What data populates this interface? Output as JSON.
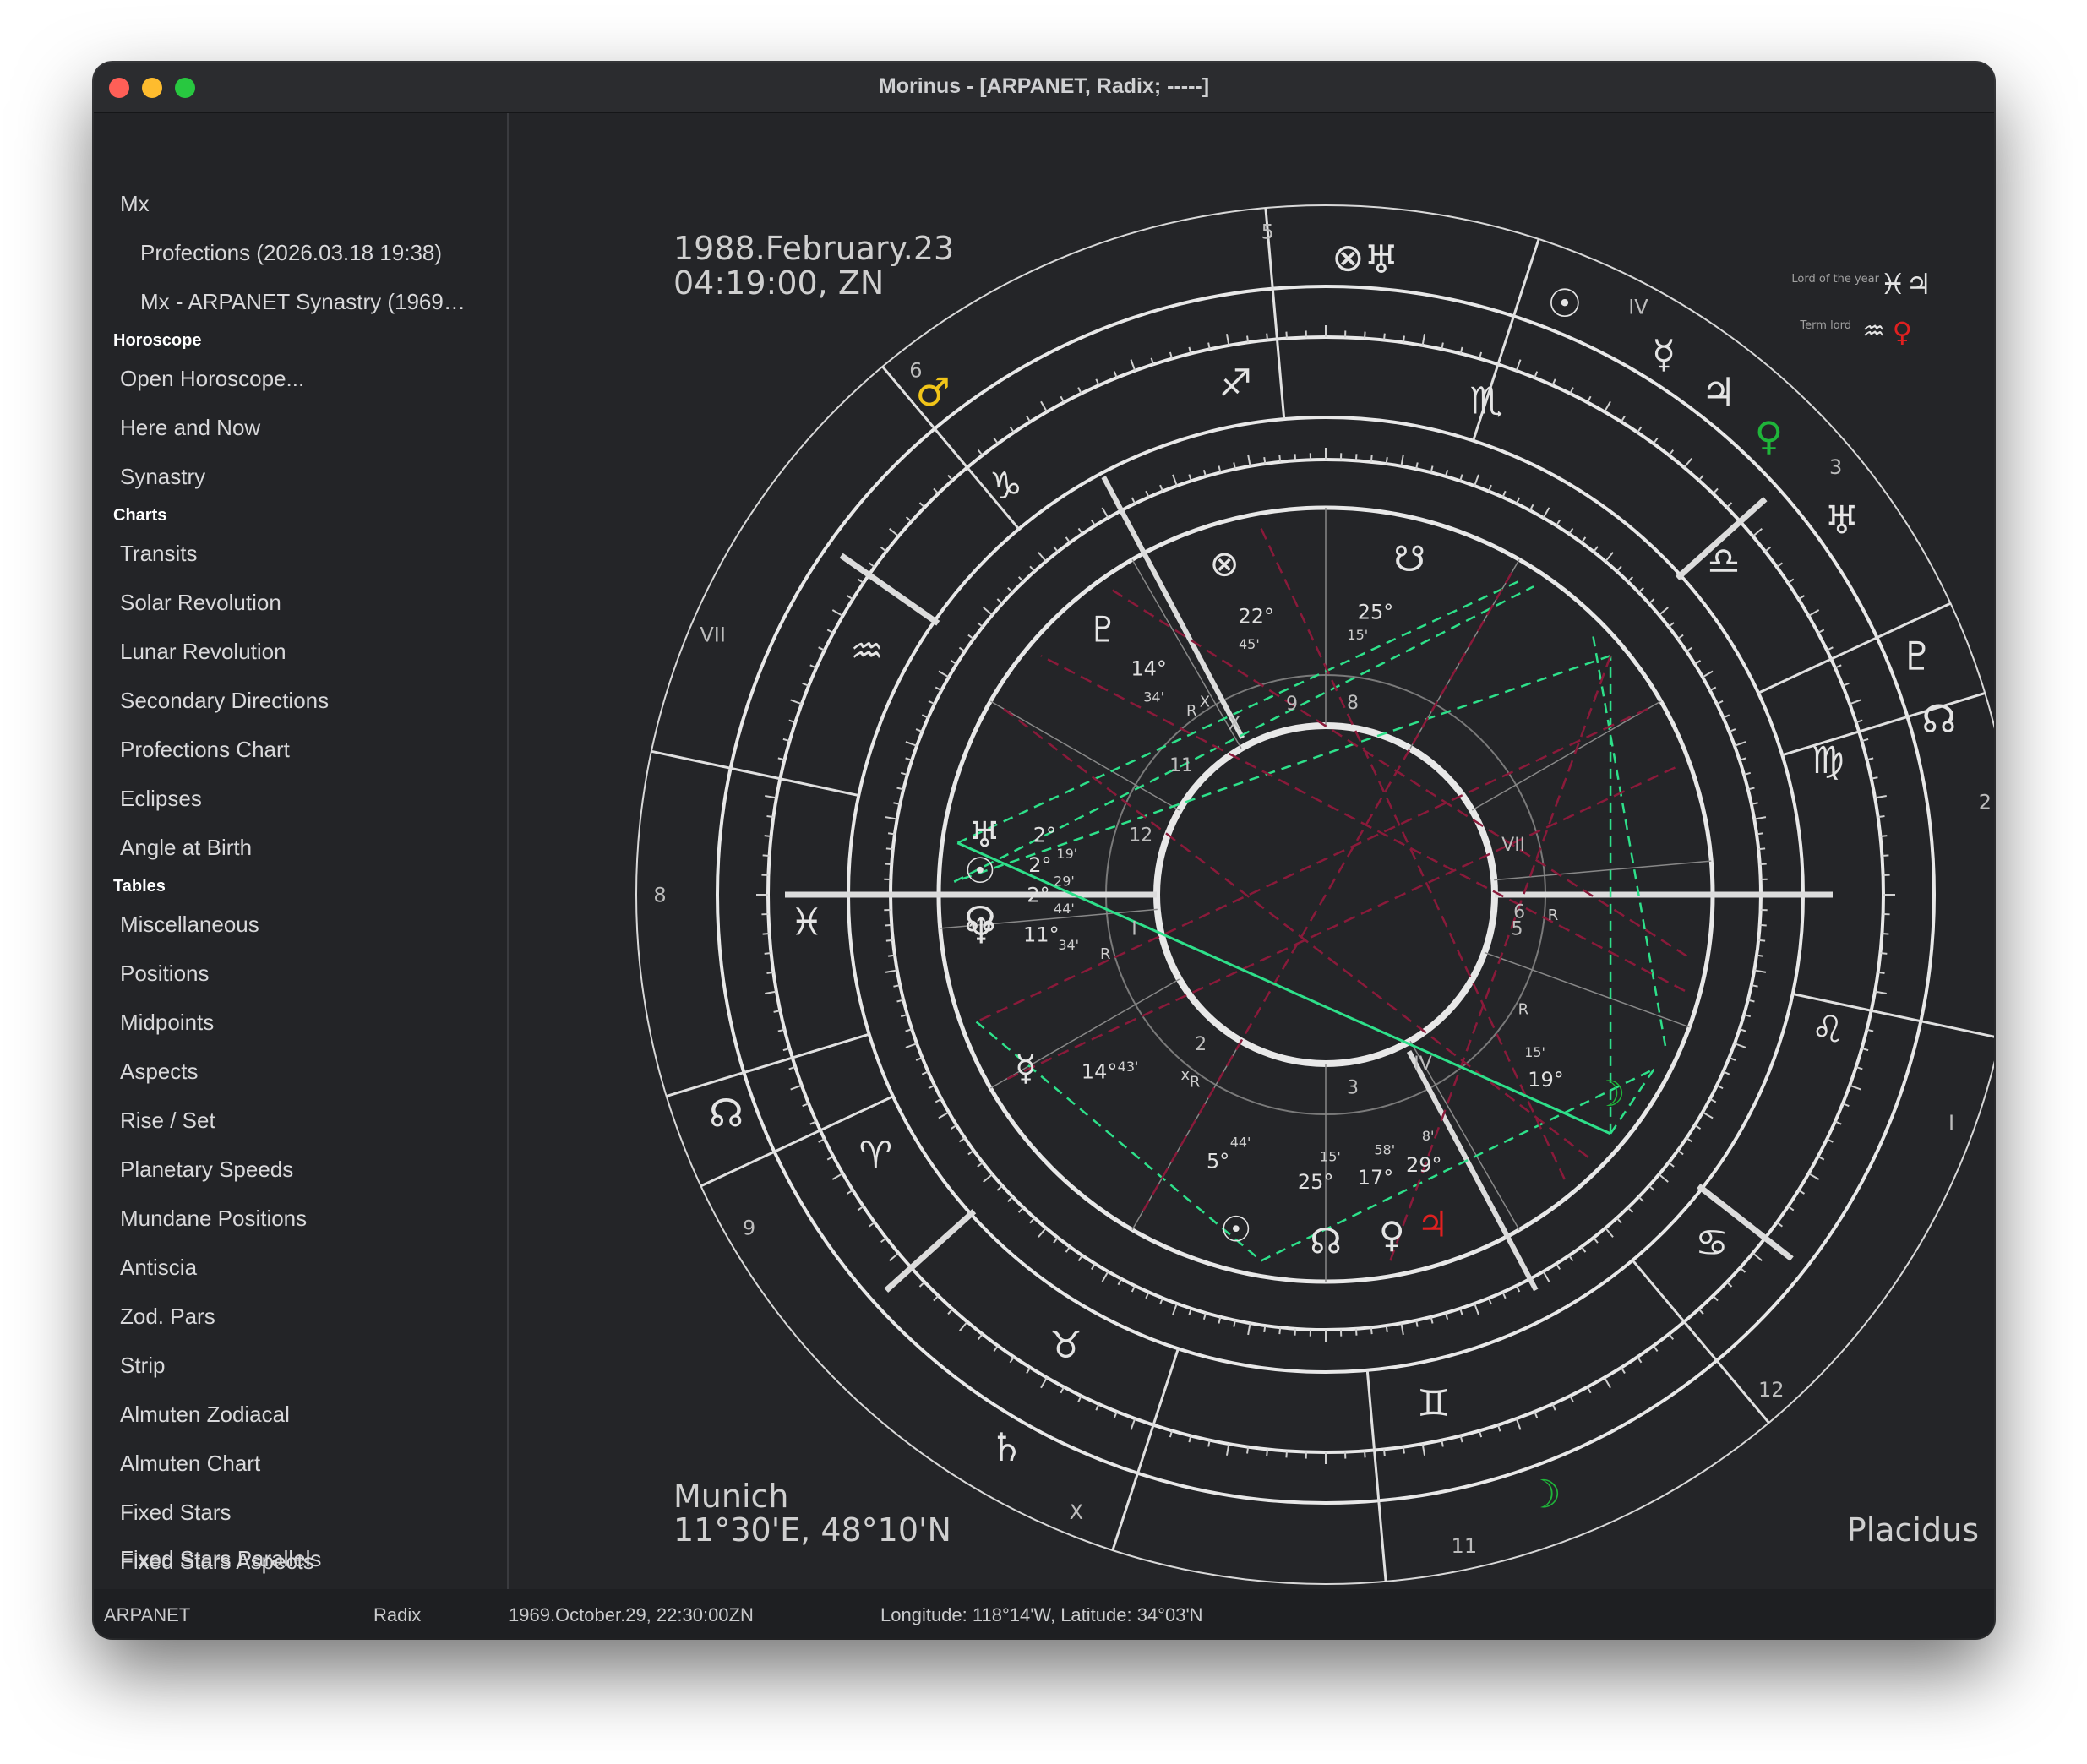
{
  "window": {
    "title": "Morinus - [ARPANET, Radix; -----]"
  },
  "sidebar": {
    "top_items": [
      "Mx",
      "Profections (2026.03.18 19:38)",
      "Mx - ARPANET Synastry (1969…"
    ],
    "horoscope_header": "Horoscope",
    "horoscope_items": [
      "Open Horoscope...",
      "Here and Now",
      "Synastry"
    ],
    "charts_header": "Charts",
    "charts_items": [
      "Transits",
      "Solar Revolution",
      "Lunar Revolution",
      "Secondary Directions",
      "Profections Chart",
      "Eclipses",
      "Angle at Birth"
    ],
    "tables_header": "Tables",
    "tables_items": [
      "Miscellaneous",
      "Positions",
      "Midpoints",
      "Aspects",
      "Rise / Set",
      "Planetary Speeds",
      "Mundane Positions",
      "Antiscia",
      "Zod. Pars",
      "Strip",
      "Almuten Zodiacal",
      "Almuten Chart",
      "Fixed Stars",
      "Fixed Stars Aspects",
      "Fixed Stars Parallels"
    ]
  },
  "chart": {
    "date_line": "1988.February.23",
    "time_line": "04:19:00, ZN",
    "place_line": "Munich",
    "coords_line": "11°30'E, 48°10'N",
    "house_system": "Placidus",
    "lord_of_year_label": "Lord of the year",
    "lord_of_year_glyphs": "♓♃",
    "term_lord_label": "Term lord",
    "term_lord_sign_glyph": "♒",
    "term_lord_planet_glyph": "♀",
    "colors": {
      "background": "#242528",
      "lines": "#e4e4e4",
      "trine": "#2ee08a",
      "square": "#8a1a3a",
      "mars": "#f0c419",
      "venus": "#1fb53a",
      "jupiter": "#e02020"
    },
    "outer_house_numbers": [
      "5",
      "IV",
      "3",
      "2",
      "I",
      "12",
      "11",
      "X",
      "9",
      "8",
      "VII",
      "6"
    ],
    "inner_house_numbers": [
      "8",
      "9",
      "X",
      "11",
      "12",
      "I",
      "2",
      "3",
      "IV",
      "5",
      "6",
      "VII"
    ],
    "signs": [
      "♏",
      "♐",
      "♑",
      "♒",
      "♓",
      "♈",
      "♉",
      "♊",
      "♋",
      "♌",
      "♍",
      "♎"
    ],
    "outer_planets": [
      "⊗",
      "♅",
      "☉",
      "☿",
      "♃",
      "♀",
      "♅",
      "♇",
      "☊",
      "♂",
      "☊",
      "♄",
      "☽"
    ],
    "inner_planets": [
      "⊗",
      "☋",
      "♇",
      "♅",
      "☉",
      "☊",
      "♆",
      "☿",
      "☉",
      "☊",
      "♀",
      "♃",
      "☽"
    ],
    "degree_labels": [
      "22°",
      "25°",
      "14°",
      "2°",
      "2°",
      "2°",
      "11°",
      "14°",
      "5°",
      "25°",
      "17°",
      "29°",
      "19°"
    ],
    "minute_labels": [
      "45'",
      "15'",
      "34'",
      "19'",
      "29'",
      "44'",
      "34'",
      "43'",
      "44'",
      "15'",
      "58'",
      "8'",
      "15'"
    ],
    "retro_labels": [
      "R",
      "X",
      "R",
      "x",
      "R",
      "R",
      "R"
    ]
  },
  "status": {
    "name": "ARPANET",
    "type": "Radix",
    "datetime": "1969.October.29, 22:30:00ZN",
    "location": "Longitude: 118°14'W, Latitude: 34°03'N"
  }
}
